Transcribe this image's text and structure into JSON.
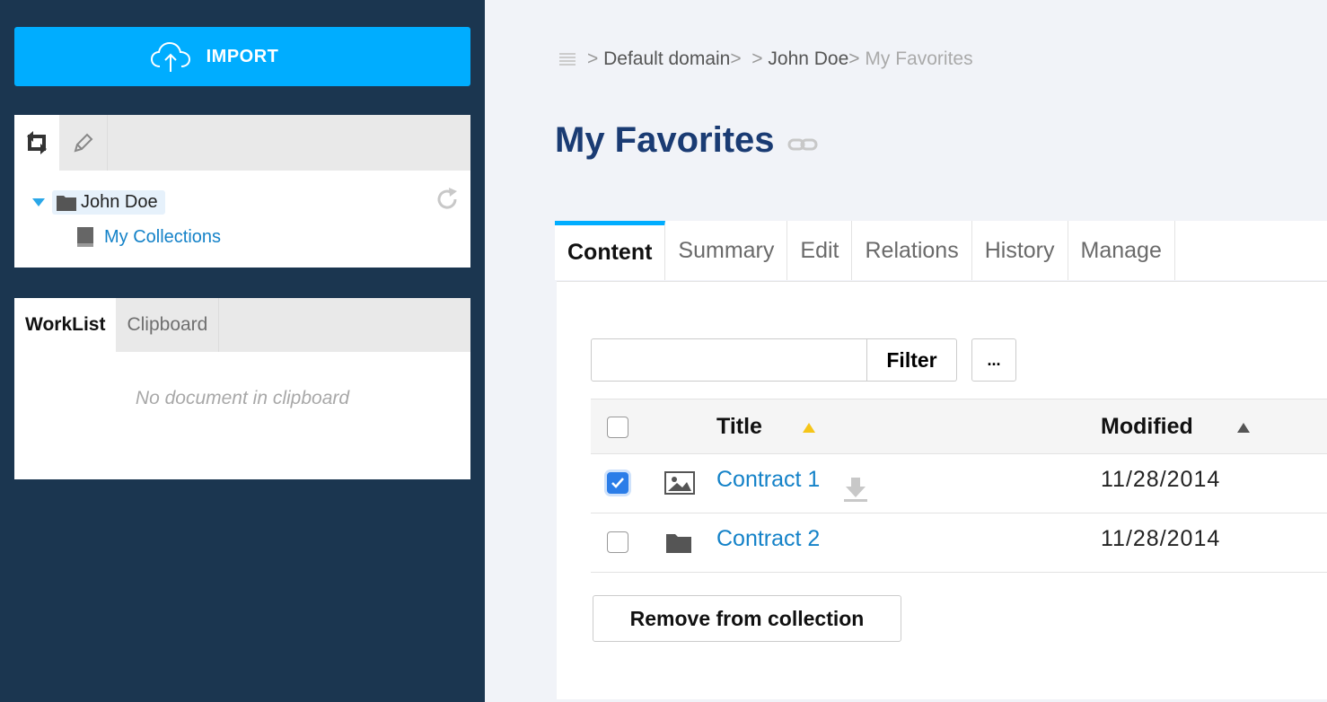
{
  "sidebar": {
    "import_label": "IMPORT",
    "tree": {
      "root_label": "John Doe",
      "child_label": "My Collections"
    },
    "worklist": {
      "tabs": [
        "WorkList",
        "Clipboard"
      ],
      "empty_text": "No document in clipboard"
    }
  },
  "breadcrumb": {
    "items": [
      "Default domain",
      "John Doe"
    ],
    "current": "My Favorites"
  },
  "page": {
    "title": "My Favorites"
  },
  "tabs": [
    "Content",
    "Summary",
    "Edit",
    "Relations",
    "History",
    "Manage"
  ],
  "filter": {
    "value": "",
    "button_label": "Filter",
    "more_label": "..."
  },
  "table": {
    "headers": {
      "title": "Title",
      "modified": "Modified"
    },
    "rows": [
      {
        "title": "Contract 1",
        "modified": "11/28/2014",
        "checked": true,
        "icon": "picture-icon"
      },
      {
        "title": "Contract 2",
        "modified": "11/28/2014",
        "checked": false,
        "icon": "folder-icon"
      }
    ]
  },
  "actions": {
    "remove_label": "Remove from collection"
  },
  "colors": {
    "sidebar_bg": "#1b3650",
    "accent": "#00adff",
    "link": "#1482c8",
    "title": "#1a3b73"
  }
}
